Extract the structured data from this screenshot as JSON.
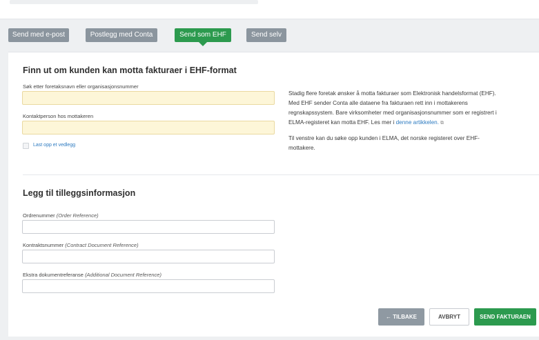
{
  "tabs": [
    {
      "label": "Send med e-post",
      "active": false
    },
    {
      "label": "Postlegg med Conta",
      "active": false
    },
    {
      "label": "Send som EHF",
      "active": true
    },
    {
      "label": "Send selv",
      "active": false
    }
  ],
  "ehf_section": {
    "title": "Finn ut om kunden kan motta fakturaer i EHF-format",
    "search_label": "Søk etter foretaksnavn eller organisasjonsnummer",
    "search_value": "",
    "contact_label": "Kontaktperson hos mottakeren",
    "contact_value": "",
    "attachment_label": "Last opp et vedlegg"
  },
  "info": {
    "line1": "Stadig flere foretak ønsker å motta fakturaer som Elektronisk handelsformat (EHF).",
    "line2": "Med EHF sender Conta alle dataene fra fakturaen rett inn i mottakerens",
    "line3": "regnskapssystem. Bare virksomheter med organisasjonsnummer som er registrert i",
    "line4_prefix": "ELMA-registeret kan motta EHF. Les mer i ",
    "line4_link": "denne artikkelen.",
    "line5": "Til venstre kan du søke opp kunden i ELMA, det norske registeret over EHF-",
    "line6": "mottakere."
  },
  "extra_section": {
    "title": "Legg til tilleggsinformasjon",
    "order_label": "Ordrenummer",
    "order_hint": "(Order Reference)",
    "contract_label": "Kontraktsnummer",
    "contract_hint": "(Contract Document Reference)",
    "extra_label": "Ekstra dokumentreferanse",
    "extra_hint": "(Additional Document Reference)"
  },
  "buttons": {
    "back": "← TILBAKE",
    "cancel": "AVBRYT",
    "send": "SEND FAKTURAEN"
  },
  "colors": {
    "accent_green": "#2c9a4e",
    "tab_grey": "#8b959e",
    "highlight_input": "#fdf6d8",
    "link_blue": "#2c7ac0"
  }
}
